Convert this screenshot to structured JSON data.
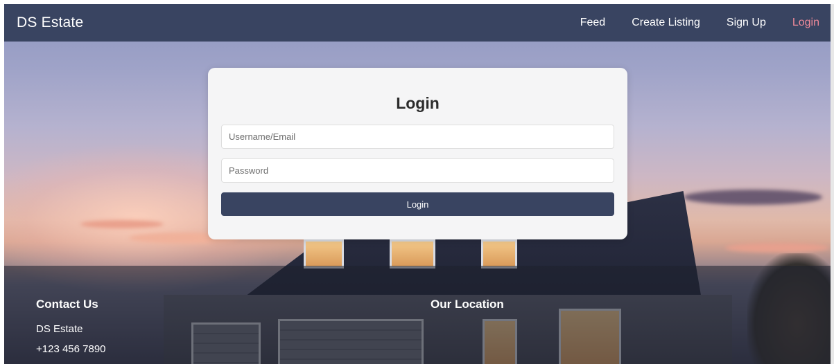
{
  "navbar": {
    "brand": "DS Estate",
    "links": [
      {
        "label": "Feed"
      },
      {
        "label": "Create Listing"
      },
      {
        "label": "Sign Up"
      },
      {
        "label": "Login"
      }
    ],
    "active_color": "#f08a9a",
    "background_color": "#394461"
  },
  "login_form": {
    "title": "Login",
    "username_placeholder": "Username/Email",
    "password_placeholder": "Password",
    "submit_label": "Login"
  },
  "footer": {
    "contact": {
      "heading": "Contact Us",
      "lines": [
        "DS Estate",
        "+123 456 7890"
      ]
    },
    "location": {
      "heading": "Our Location"
    }
  }
}
